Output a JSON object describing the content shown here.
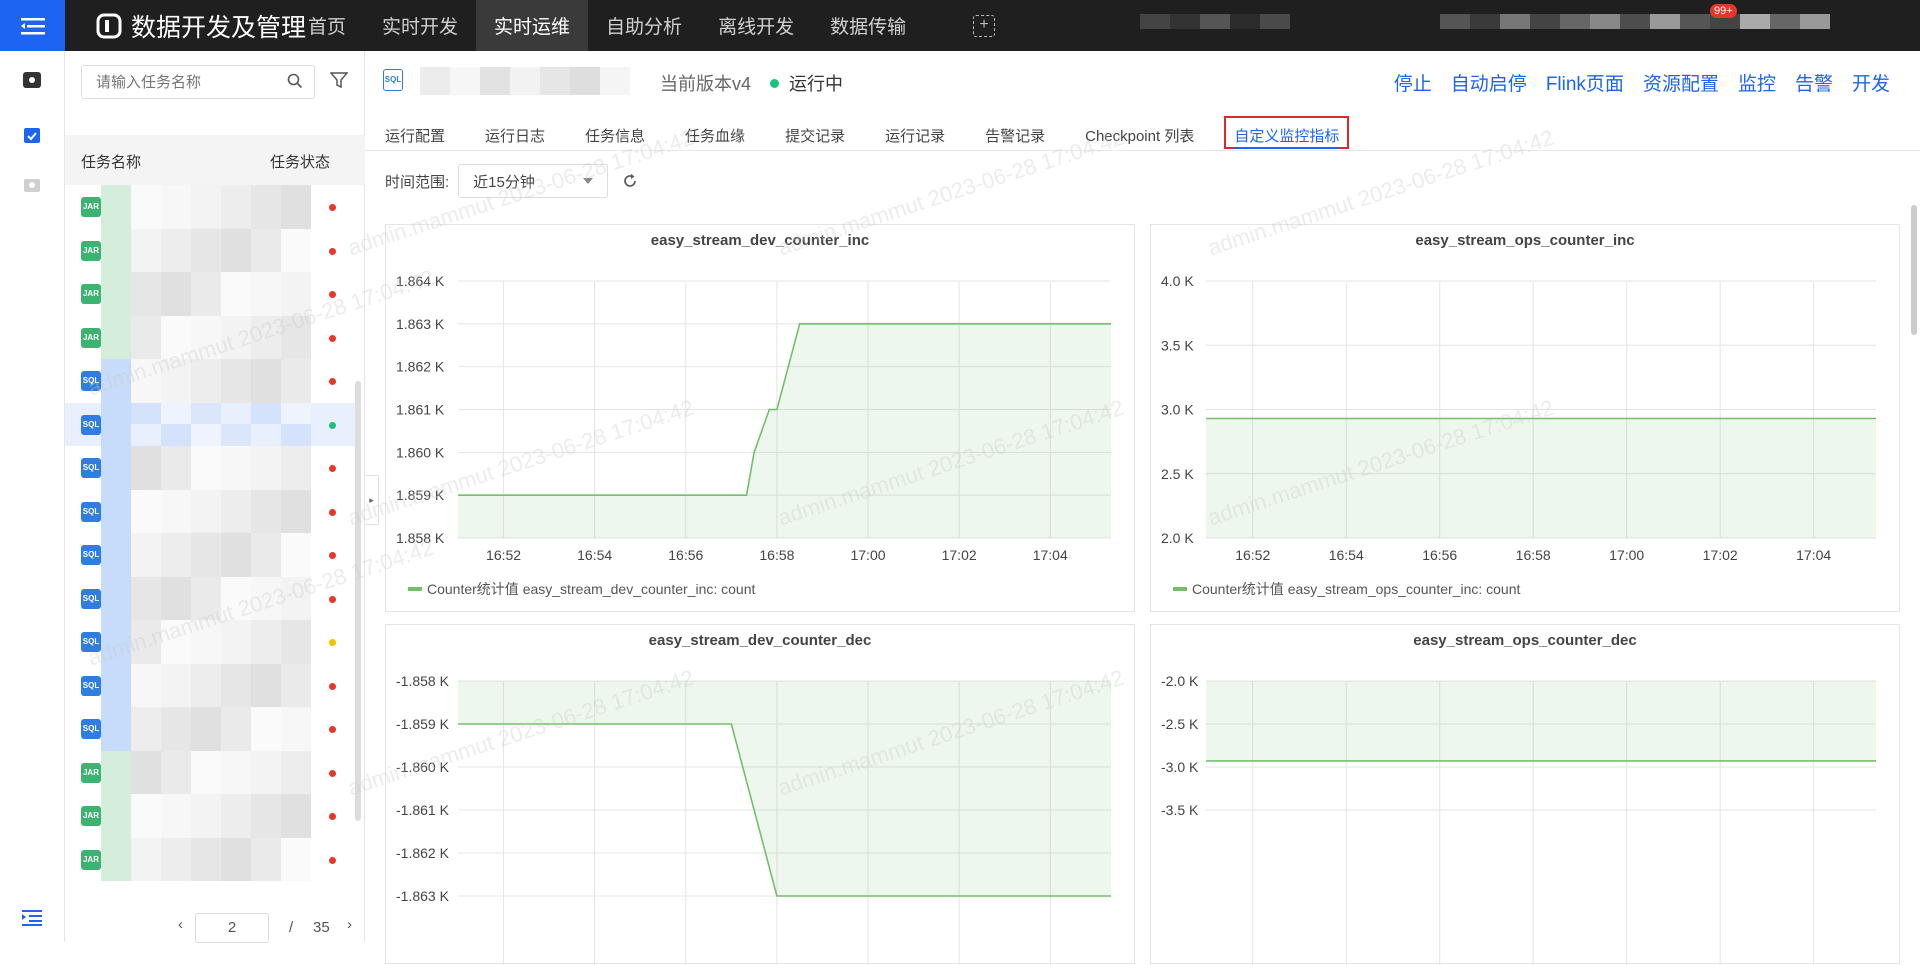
{
  "header": {
    "logo_text": "数据开发及管理",
    "nav": [
      {
        "label": "首页",
        "active": false
      },
      {
        "label": "实时开发",
        "active": false
      },
      {
        "label": "实时运维",
        "active": true
      },
      {
        "label": "自助分析",
        "active": false
      },
      {
        "label": "离线开发",
        "active": false
      },
      {
        "label": "数据传输",
        "active": false
      }
    ],
    "notification_badge": "99+"
  },
  "sidebar": {
    "search_placeholder": "请输入任务名称",
    "col_name": "任务名称",
    "col_status": "任务状态",
    "rows": [
      {
        "type": "JAR",
        "status": "red"
      },
      {
        "type": "JAR",
        "status": "red"
      },
      {
        "type": "JAR",
        "status": "red"
      },
      {
        "type": "JAR",
        "status": "red"
      },
      {
        "type": "SQL",
        "status": "red"
      },
      {
        "type": "SQL",
        "status": "green",
        "selected": true
      },
      {
        "type": "SQL",
        "status": "red"
      },
      {
        "type": "SQL",
        "status": "red"
      },
      {
        "type": "SQL",
        "status": "red"
      },
      {
        "type": "SQL",
        "status": "red"
      },
      {
        "type": "SQL",
        "status": "yellow"
      },
      {
        "type": "SQL",
        "status": "red"
      },
      {
        "type": "SQL",
        "status": "red"
      },
      {
        "type": "JAR",
        "status": "red"
      },
      {
        "type": "JAR",
        "status": "red"
      },
      {
        "type": "JAR",
        "status": "red"
      }
    ],
    "pager": {
      "current": "2",
      "separator": "/",
      "total": "35"
    }
  },
  "job": {
    "version": "当前版本v4",
    "status": "运行中",
    "actions": [
      "停止",
      "自动启停",
      "Flink页面",
      "资源配置",
      "监控",
      "告警",
      "开发"
    ]
  },
  "tabs": [
    "运行配置",
    "运行日志",
    "任务信息",
    "任务血缘",
    "提交记录",
    "运行记录",
    "告警记录",
    "Checkpoint 列表",
    "自定义监控指标"
  ],
  "active_tab": 8,
  "time_range": {
    "label": "时间范围:",
    "value": "近15分钟"
  },
  "watermark": "admin.mammut 2023-06-28 17:04:42",
  "colors": {
    "accent": "#1d64f2",
    "series": "#73bf69",
    "running": "#19c37d",
    "error": "#e5372a",
    "warn": "#f2c200"
  },
  "chart_data": [
    {
      "type": "area",
      "title": "easy_stream_dev_counter_inc",
      "x_ticks": [
        "16:52",
        "16:54",
        "16:56",
        "16:58",
        "17:00",
        "17:02",
        "17:04"
      ],
      "y_ticks": [
        "1.864 K",
        "1.863 K",
        "1.862 K",
        "1.861 K",
        "1.860 K",
        "1.859 K",
        "1.858 K"
      ],
      "ylim": [
        1858,
        1864
      ],
      "x": [
        "16:51:00",
        "16:57:20",
        "16:57:30",
        "16:57:50",
        "16:58:00",
        "16:58:30",
        "17:05:20"
      ],
      "series": [
        {
          "name": "Counter统计值 easy_stream_dev_counter_inc: count",
          "values": [
            1859,
            1859,
            1860,
            1861,
            1861,
            1863,
            1863
          ]
        }
      ]
    },
    {
      "type": "area",
      "title": "easy_stream_ops_counter_inc",
      "x_ticks": [
        "16:52",
        "16:54",
        "16:56",
        "16:58",
        "17:00",
        "17:02",
        "17:04"
      ],
      "y_ticks": [
        "4.0 K",
        "3.5 K",
        "3.0 K",
        "2.5 K",
        "2.0 K"
      ],
      "ylim": [
        2000,
        4000
      ],
      "x": [
        "16:51:00",
        "17:05:20"
      ],
      "series": [
        {
          "name": "Counter统计值 easy_stream_ops_counter_inc: count",
          "values": [
            2930,
            2930
          ]
        }
      ]
    },
    {
      "type": "area",
      "title": "easy_stream_dev_counter_dec",
      "x_ticks": [],
      "y_ticks": [
        "-1.858 K",
        "-1.859 K",
        "-1.860 K",
        "-1.861 K",
        "-1.862 K",
        "-1.863 K"
      ],
      "ylim": [
        -1863,
        -1858
      ],
      "x": [
        "16:51:00",
        "16:57:00",
        "16:58:00",
        "17:05:20"
      ],
      "series": [
        {
          "name": "",
          "values": [
            -1859,
            -1859,
            -1863,
            -1863
          ]
        }
      ]
    },
    {
      "type": "area",
      "title": "easy_stream_ops_counter_dec",
      "x_ticks": [],
      "y_ticks": [
        "-2.0 K",
        "-2.5 K",
        "-3.0 K",
        "-3.5 K"
      ],
      "ylim": [
        -3500,
        -2000
      ],
      "x": [
        "16:51:00",
        "17:05:20"
      ],
      "series": [
        {
          "name": "",
          "values": [
            -2930,
            -2930
          ]
        }
      ]
    }
  ]
}
